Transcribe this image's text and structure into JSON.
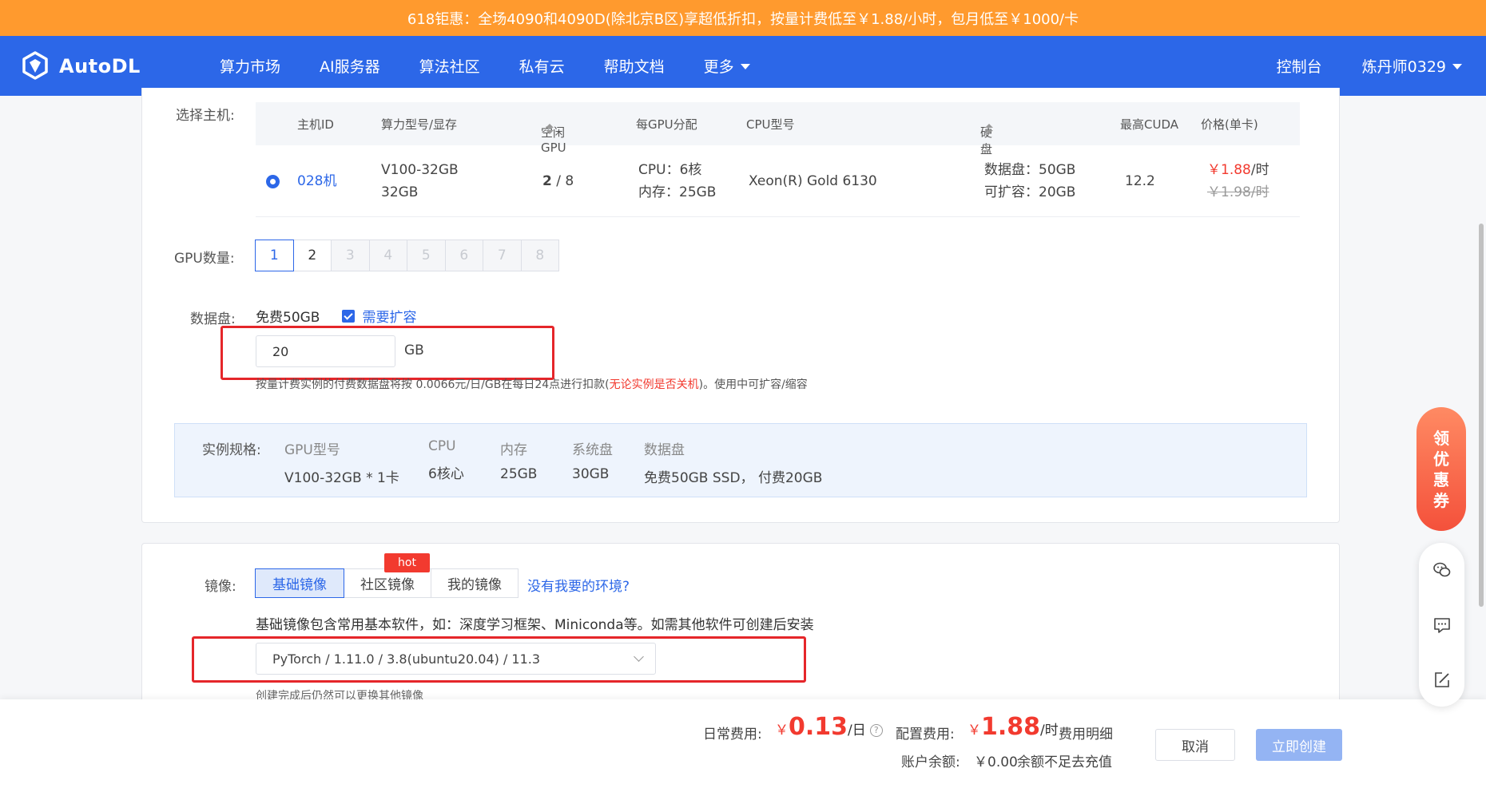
{
  "promo": {
    "text": "618钜惠：全场4090和4090D(除北京B区)享超低折扣，按量计费低至￥1.88/小时，包月低至￥1000/卡"
  },
  "nav": {
    "logo": "AutoDL",
    "links": [
      "算力市场",
      "AI服务器",
      "算法社区",
      "私有云",
      "帮助文档",
      "更多"
    ],
    "console": "控制台",
    "user": "炼丹师0329"
  },
  "host_select": {
    "label": "选择主机:",
    "headers": [
      "主机ID",
      "算力型号/显存",
      "空闲GPU",
      "每GPU分配",
      "CPU型号",
      "硬盘",
      "最高CUDA",
      "价格(单卡)"
    ],
    "row": {
      "id": "028机",
      "model": "V100-32GB",
      "vram": "32GB",
      "gpu_free": "2",
      "gpu_total": " / 8",
      "cpu_alloc": "CPU：6核",
      "mem_alloc": "内存：25GB",
      "cpu_model": "Xeon(R) Gold 6130",
      "disk_data": "数据盘：50GB",
      "disk_expand": "可扩容：20GB",
      "cuda": "12.2",
      "price": "￥1.88",
      "price_unit": "/时",
      "price_old": "￥1.98/时"
    }
  },
  "gpu_count": {
    "label": "GPU数量:",
    "options": [
      "1",
      "2",
      "3",
      "4",
      "5",
      "6",
      "7",
      "8"
    ],
    "selected": "1"
  },
  "data_disk": {
    "label": "数据盘:",
    "free": "免费50GB",
    "expand_checked": true,
    "expand_label": "需要扩容",
    "value": "20",
    "unit": "GB",
    "hint_a": "按量计费实例的付费数据盘将按 0.0066元/日/GB在每日24点进行扣款(",
    "hint_red": "无论实例是否关机",
    "hint_b": ")。使用中可扩容/缩容"
  },
  "spec": {
    "label": "实例规格:",
    "cols": [
      {
        "h": "GPU型号",
        "v": "V100-32GB * 1卡"
      },
      {
        "h": "CPU",
        "v": "6核心"
      },
      {
        "h": "内存",
        "v": "25GB"
      },
      {
        "h": "系统盘",
        "v": "30GB"
      },
      {
        "h": "数据盘",
        "v": "免费50GB SSD， 付费20GB"
      }
    ]
  },
  "image": {
    "label": "镜像:",
    "tabs": [
      "基础镜像",
      "社区镜像",
      "我的镜像"
    ],
    "hot": "hot",
    "no_env_link": "没有我要的环境?",
    "desc": "基础镜像包含常用基本软件，如：深度学习框架、Miniconda等。如需其他软件可创建后安装",
    "selected": "PyTorch / 1.11.0 / 3.8(ubuntu20.04) / 11.3",
    "note": "创建完成后仍然可以更换其他镜像"
  },
  "footer": {
    "daily_label": "日常费用:",
    "daily_currency": "￥",
    "daily_value": "0.13",
    "daily_unit": "/日",
    "config_label": "配置费用:",
    "config_currency": "￥",
    "config_value": "1.88",
    "config_unit": "/时",
    "fee_detail": "费用明细",
    "balance_label": "账户余额:",
    "balance_value": "￥0.00",
    "recharge": "余额不足去充值",
    "cancel": "取消",
    "create": "立即创建"
  },
  "side": {
    "coupon": [
      "领",
      "优",
      "惠",
      "券"
    ],
    "icons": [
      "wechat-icon",
      "chat-icon",
      "edit-icon"
    ]
  },
  "colors": {
    "brand": "#2c67e8",
    "promo": "#ff9a2e",
    "price": "#f23a2f",
    "highlight": "#e5262a"
  }
}
